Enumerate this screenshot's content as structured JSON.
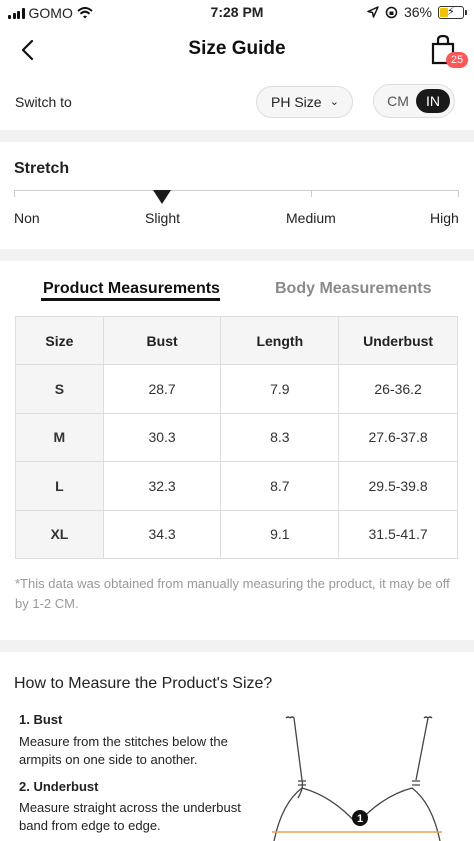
{
  "status_bar": {
    "carrier": "GOMO",
    "time": "7:28 PM",
    "battery": "36%",
    "battery_level": 0.36
  },
  "header": {
    "title": "Size Guide",
    "bag_count": "25"
  },
  "switch": {
    "label": "Switch to",
    "region": "PH Size",
    "units": [
      "CM",
      "IN"
    ],
    "selected_unit": "IN"
  },
  "stretch": {
    "title": "Stretch",
    "levels": [
      "Non",
      "Slight",
      "Medium",
      "High"
    ],
    "selected": "Slight"
  },
  "tabs": {
    "product": "Product Measurements",
    "body": "Body Measurements",
    "active": "Product Measurements"
  },
  "table": {
    "headers": [
      "Size",
      "Bust",
      "Length",
      "Underbust"
    ],
    "rows": [
      [
        "S",
        "28.7",
        "7.9",
        "26-36.2"
      ],
      [
        "M",
        "30.3",
        "8.3",
        "27.6-37.8"
      ],
      [
        "L",
        "32.3",
        "8.7",
        "29.5-39.8"
      ],
      [
        "XL",
        "34.3",
        "9.1",
        "31.5-41.7"
      ]
    ]
  },
  "footnote": "*This data was obtained from manually measuring the product, it may be off by 1-2 CM.",
  "measure": {
    "title": "How to Measure the Product's Size?",
    "steps": [
      {
        "heading": "1. Bust",
        "text": "Measure from the stitches below the armpits on one side to another."
      },
      {
        "heading": "2. Underbust",
        "text": "Measure straight across the underbust band from edge to edge."
      }
    ],
    "marker": "1"
  }
}
